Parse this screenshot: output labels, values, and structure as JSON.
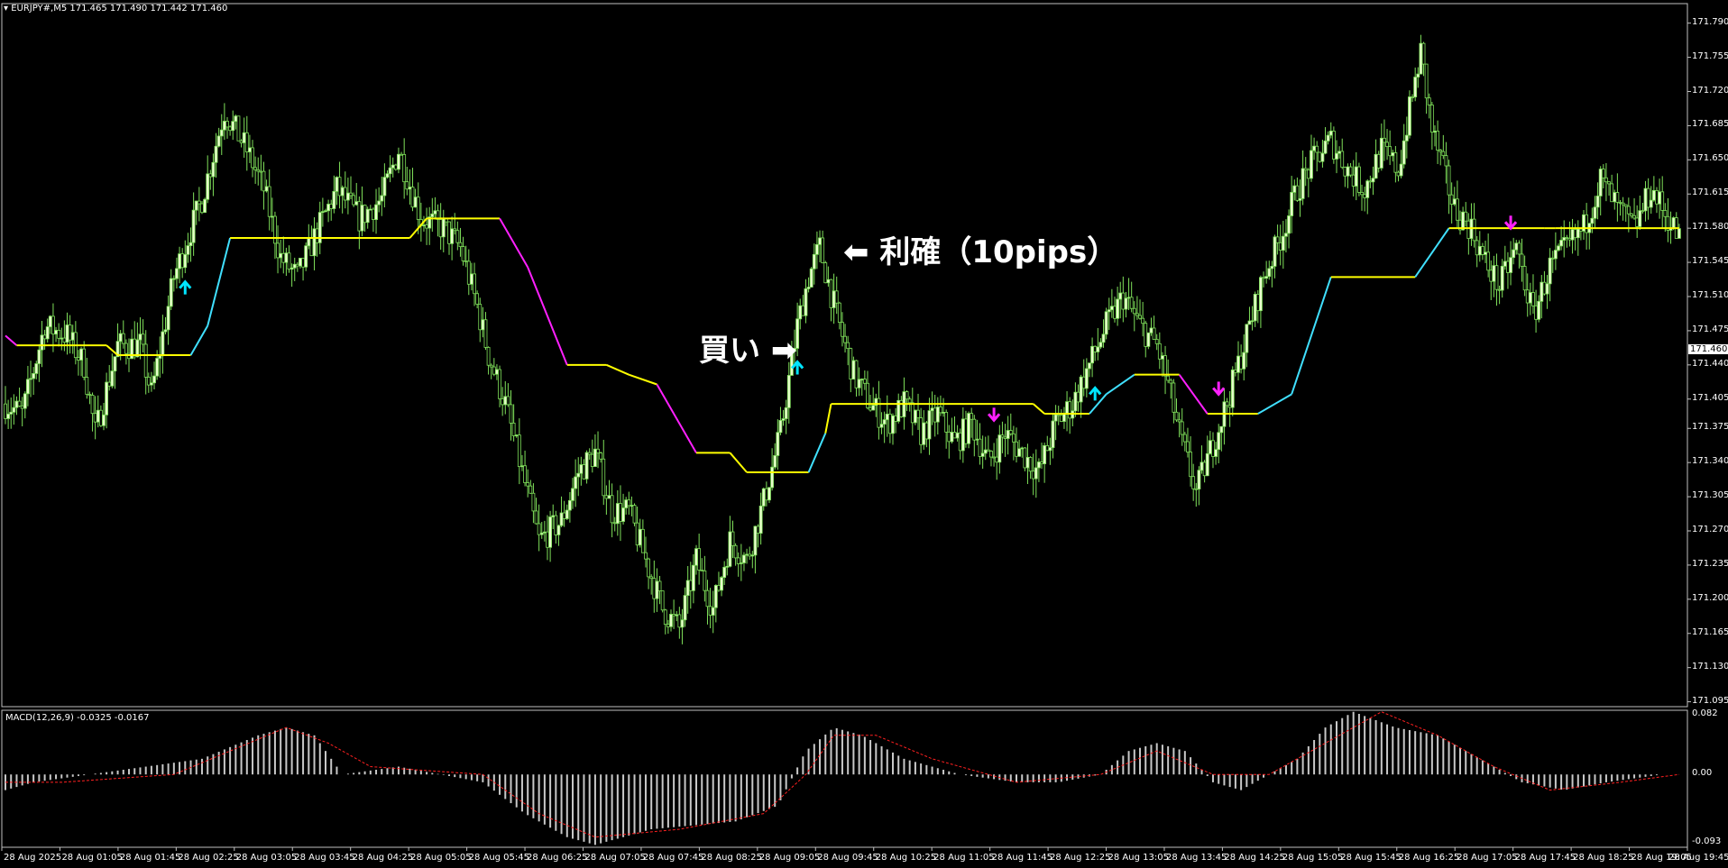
{
  "title": "EURJPY#,M5  171.465 171.490 171.442 171.460",
  "annotations": {
    "buy": "買い ➡",
    "take_profit": "⬅ 利確（10pips）"
  },
  "current_price": "171.460",
  "colors": {
    "background": "#000000",
    "candle": "#7fe05a",
    "candle_body_up": "#e8ffcc",
    "line_flat": "#ffff00",
    "line_up": "#40e0ff",
    "line_down": "#ff20ff",
    "arrow_buy": "#00e5ff",
    "arrow_sell": "#ff20ff",
    "macd_hist": "#c8c8c8",
    "macd_signal": "#ff2020"
  },
  "chart_data": [
    {
      "type": "candlestick",
      "symbol": "EURJPY#",
      "timeframe": "M5",
      "ylim": [
        171.09,
        171.81
      ],
      "y_ticks": [
        "171.790",
        "171.755",
        "171.720",
        "171.685",
        "171.650",
        "171.615",
        "171.580",
        "171.545",
        "171.510",
        "171.475",
        "171.440",
        "171.405",
        "171.375",
        "171.340",
        "171.305",
        "171.270",
        "171.235",
        "171.200",
        "171.165",
        "171.130",
        "171.095"
      ],
      "x_ticks": [
        "28 Aug 2025",
        "28 Aug 01:05",
        "28 Aug 01:45",
        "28 Aug 02:25",
        "28 Aug 03:05",
        "28 Aug 03:45",
        "28 Aug 04:25",
        "28 Aug 05:05",
        "28 Aug 05:45",
        "28 Aug 06:25",
        "28 Aug 07:05",
        "28 Aug 07:45",
        "28 Aug 08:25",
        "28 Aug 09:05",
        "28 Aug 09:45",
        "28 Aug 10:25",
        "28 Aug 11:05",
        "28 Aug 11:45",
        "28 Aug 12:25",
        "28 Aug 13:05",
        "28 Aug 13:45",
        "28 Aug 14:25",
        "28 Aug 15:05",
        "28 Aug 15:45",
        "28 Aug 16:25",
        "28 Aug 17:05",
        "28 Aug 17:45",
        "28 Aug 18:25",
        "28 Aug 19:05",
        "28 Aug 19:45"
      ],
      "close_path": [
        [
          0,
          171.4
        ],
        [
          6,
          171.39
        ],
        [
          14,
          171.48
        ],
        [
          22,
          171.47
        ],
        [
          28,
          171.44
        ],
        [
          32,
          171.37
        ],
        [
          40,
          171.46
        ],
        [
          48,
          171.46
        ],
        [
          52,
          171.41
        ],
        [
          60,
          171.53
        ],
        [
          70,
          171.61
        ],
        [
          78,
          171.7
        ],
        [
          86,
          171.66
        ],
        [
          92,
          171.62
        ],
        [
          98,
          171.55
        ],
        [
          104,
          171.53
        ],
        [
          110,
          171.57
        ],
        [
          118,
          171.62
        ],
        [
          126,
          171.59
        ],
        [
          134,
          171.61
        ],
        [
          140,
          171.66
        ],
        [
          148,
          171.59
        ],
        [
          156,
          171.58
        ],
        [
          162,
          171.56
        ],
        [
          168,
          171.5
        ],
        [
          172,
          171.45
        ],
        [
          178,
          171.4
        ],
        [
          184,
          171.33
        ],
        [
          190,
          171.26
        ],
        [
          198,
          171.28
        ],
        [
          204,
          171.33
        ],
        [
          210,
          171.35
        ],
        [
          216,
          171.29
        ],
        [
          222,
          171.29
        ],
        [
          228,
          171.24
        ],
        [
          234,
          171.19
        ],
        [
          240,
          171.17
        ],
        [
          246,
          171.24
        ],
        [
          252,
          171.19
        ],
        [
          258,
          171.26
        ],
        [
          264,
          171.24
        ],
        [
          270,
          171.3
        ],
        [
          276,
          171.37
        ],
        [
          282,
          171.48
        ],
        [
          286,
          171.53
        ],
        [
          290,
          171.56
        ],
        [
          296,
          171.49
        ],
        [
          302,
          171.43
        ],
        [
          308,
          171.4
        ],
        [
          314,
          171.38
        ],
        [
          320,
          171.4
        ],
        [
          326,
          171.37
        ],
        [
          332,
          171.39
        ],
        [
          338,
          171.36
        ],
        [
          344,
          171.38
        ],
        [
          350,
          171.34
        ],
        [
          356,
          171.37
        ],
        [
          362,
          171.35
        ],
        [
          368,
          171.33
        ],
        [
          374,
          171.38
        ],
        [
          380,
          171.4
        ],
        [
          386,
          171.44
        ],
        [
          392,
          171.48
        ],
        [
          398,
          171.51
        ],
        [
          404,
          171.48
        ],
        [
          410,
          171.46
        ],
        [
          414,
          171.42
        ],
        [
          418,
          171.37
        ],
        [
          424,
          171.31
        ],
        [
          430,
          171.36
        ],
        [
          436,
          171.41
        ],
        [
          442,
          171.47
        ],
        [
          448,
          171.53
        ],
        [
          454,
          171.57
        ],
        [
          460,
          171.62
        ],
        [
          466,
          171.65
        ],
        [
          472,
          171.67
        ],
        [
          478,
          171.64
        ],
        [
          484,
          171.62
        ],
        [
          490,
          171.66
        ],
        [
          496,
          171.64
        ],
        [
          500,
          171.7
        ],
        [
          504,
          171.76
        ],
        [
          508,
          171.68
        ],
        [
          512,
          171.64
        ],
        [
          516,
          171.6
        ],
        [
          522,
          171.58
        ],
        [
          526,
          171.55
        ],
        [
          532,
          171.52
        ],
        [
          538,
          171.56
        ],
        [
          544,
          171.49
        ],
        [
          550,
          171.54
        ],
        [
          556,
          171.56
        ],
        [
          562,
          171.58
        ],
        [
          568,
          171.63
        ],
        [
          574,
          171.6
        ],
        [
          580,
          171.58
        ],
        [
          586,
          171.62
        ],
        [
          592,
          171.59
        ],
        [
          596,
          171.57
        ]
      ],
      "signal_line": [
        [
          0,
          171.47,
          "down"
        ],
        [
          4,
          171.46,
          "flat"
        ],
        [
          36,
          171.46,
          "flat"
        ],
        [
          40,
          171.45,
          "flat"
        ],
        [
          66,
          171.45,
          "up"
        ],
        [
          72,
          171.48,
          "up"
        ],
        [
          80,
          171.57,
          "flat"
        ],
        [
          144,
          171.57,
          "flat"
        ],
        [
          150,
          171.59,
          "flat"
        ],
        [
          176,
          171.59,
          "down"
        ],
        [
          186,
          171.54,
          "down"
        ],
        [
          200,
          171.44,
          "flat"
        ],
        [
          214,
          171.44,
          "flat"
        ],
        [
          222,
          171.43,
          "flat"
        ],
        [
          232,
          171.42,
          "down"
        ],
        [
          246,
          171.35,
          "flat"
        ],
        [
          258,
          171.35,
          "flat"
        ],
        [
          264,
          171.33,
          "flat"
        ],
        [
          286,
          171.33,
          "up"
        ],
        [
          292,
          171.37,
          "flat"
        ],
        [
          294,
          171.4,
          "flat"
        ],
        [
          366,
          171.4,
          "flat"
        ],
        [
          370,
          171.39,
          "flat"
        ],
        [
          386,
          171.39,
          "up"
        ],
        [
          392,
          171.41,
          "up"
        ],
        [
          402,
          171.43,
          "flat"
        ],
        [
          418,
          171.43,
          "down"
        ],
        [
          428,
          171.39,
          "flat"
        ],
        [
          446,
          171.39,
          "up"
        ],
        [
          458,
          171.41,
          "up"
        ],
        [
          472,
          171.53,
          "flat"
        ],
        [
          502,
          171.53,
          "up"
        ],
        [
          514,
          171.58,
          "flat"
        ],
        [
          548,
          171.58,
          "flat"
        ],
        [
          552,
          171.58,
          "flat"
        ],
        [
          596,
          171.58,
          "flat"
        ]
      ],
      "buy_arrows": [
        64,
        282,
        388
      ],
      "sell_arrows": [
        352,
        432,
        536
      ]
    },
    {
      "type": "bar",
      "name": "MACD(12,26,9) -0.0325 -0.0167",
      "ylim": [
        -0.093,
        0.082
      ],
      "y_ticks": [
        "0.082",
        "0.00",
        "-0.093"
      ],
      "hist_path": [
        [
          0,
          -0.02
        ],
        [
          10,
          -0.01
        ],
        [
          30,
          0.0
        ],
        [
          50,
          0.01
        ],
        [
          70,
          0.02
        ],
        [
          90,
          0.05
        ],
        [
          100,
          0.06
        ],
        [
          110,
          0.05
        ],
        [
          120,
          0.0
        ],
        [
          140,
          0.01
        ],
        [
          155,
          0.0
        ],
        [
          170,
          -0.01
        ],
        [
          185,
          -0.05
        ],
        [
          200,
          -0.08
        ],
        [
          210,
          -0.09
        ],
        [
          230,
          -0.07
        ],
        [
          260,
          -0.06
        ],
        [
          275,
          -0.04
        ],
        [
          285,
          0.03
        ],
        [
          295,
          0.06
        ],
        [
          305,
          0.05
        ],
        [
          320,
          0.02
        ],
        [
          340,
          0.0
        ],
        [
          360,
          -0.01
        ],
        [
          375,
          -0.01
        ],
        [
          390,
          0.0
        ],
        [
          400,
          0.03
        ],
        [
          410,
          0.04
        ],
        [
          420,
          0.03
        ],
        [
          430,
          -0.01
        ],
        [
          440,
          -0.02
        ],
        [
          450,
          0.0
        ],
        [
          460,
          0.02
        ],
        [
          470,
          0.06
        ],
        [
          480,
          0.08
        ],
        [
          495,
          0.06
        ],
        [
          510,
          0.05
        ],
        [
          525,
          0.02
        ],
        [
          540,
          -0.01
        ],
        [
          555,
          -0.02
        ],
        [
          570,
          -0.01
        ],
        [
          590,
          0.0
        ],
        [
          596,
          0.0
        ]
      ],
      "signal_path": [
        [
          0,
          -0.01
        ],
        [
          20,
          -0.01
        ],
        [
          60,
          0.0
        ],
        [
          80,
          0.03
        ],
        [
          100,
          0.06
        ],
        [
          115,
          0.04
        ],
        [
          130,
          0.01
        ],
        [
          170,
          0.0
        ],
        [
          190,
          -0.05
        ],
        [
          210,
          -0.08
        ],
        [
          240,
          -0.07
        ],
        [
          270,
          -0.05
        ],
        [
          285,
          0.0
        ],
        [
          295,
          0.05
        ],
        [
          310,
          0.05
        ],
        [
          330,
          0.02
        ],
        [
          360,
          -0.01
        ],
        [
          390,
          0.0
        ],
        [
          410,
          0.03
        ],
        [
          430,
          0.0
        ],
        [
          450,
          0.0
        ],
        [
          470,
          0.04
        ],
        [
          490,
          0.08
        ],
        [
          510,
          0.05
        ],
        [
          530,
          0.01
        ],
        [
          550,
          -0.02
        ],
        [
          575,
          -0.01
        ],
        [
          596,
          0.0
        ]
      ]
    }
  ]
}
